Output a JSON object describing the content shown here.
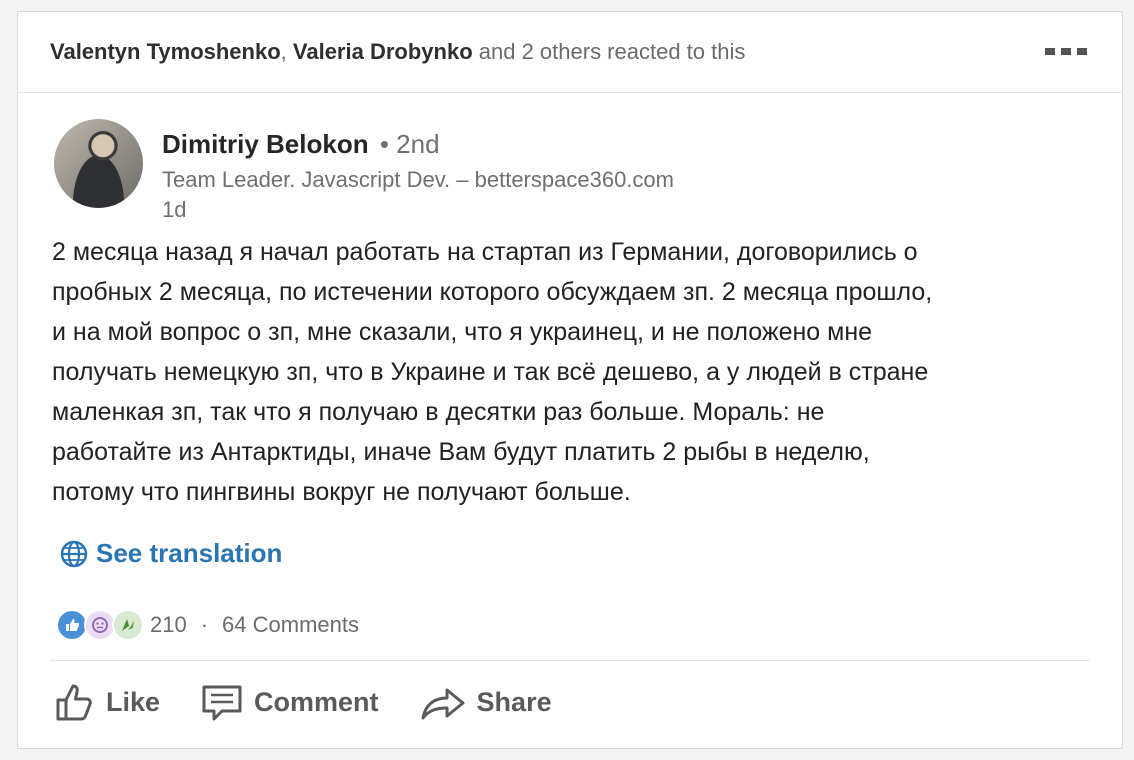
{
  "reaction_header": {
    "user1": "Valentyn Tymoshenko",
    "sep": ", ",
    "user2": "Valeria Drobynko",
    "rest": " and 2 others reacted to this"
  },
  "author": {
    "name": "Dimitriy Belokon",
    "degree": "• 2nd",
    "title": "Team Leader. Javascript Dev. – betterspace360.com",
    "time": "1d"
  },
  "post": {
    "lines": [
      "2 месяца назад я начал работать на стартап из Германии, договорились о",
      "пробных 2 месяца, по истечении которого обсуждаем зп. 2 месяца прошло,",
      "и на мой вопрос о зп, мне сказали, что я украинец, и не положено мне",
      "получать немецкую зп, что в Украине и так всё дешево, а у людей в стране",
      "маленкая зп, так что я получаю в десятки раз больше. Мораль: не",
      "работайте из Антарктиды, иначе Вам будут платить 2 рыбы в неделю,",
      "потому что пингвины вокруг не получают больше."
    ]
  },
  "translate_label": "See translation",
  "counts": {
    "reactions": "210",
    "sep": "·",
    "comments": "64 Comments"
  },
  "actions": {
    "like": "Like",
    "comment": "Comment",
    "share": "Share"
  },
  "colors": {
    "link": "#2a75b3",
    "like_blue": "#4a90d9",
    "curious_purple": "#8f6bb3",
    "celebrate_green": "#4f8a3a"
  },
  "icons": [
    "more-icon",
    "globe-icon",
    "like-reaction-icon",
    "curious-reaction-icon",
    "celebrate-reaction-icon",
    "thumbs-up-icon",
    "comment-icon",
    "share-icon"
  ]
}
